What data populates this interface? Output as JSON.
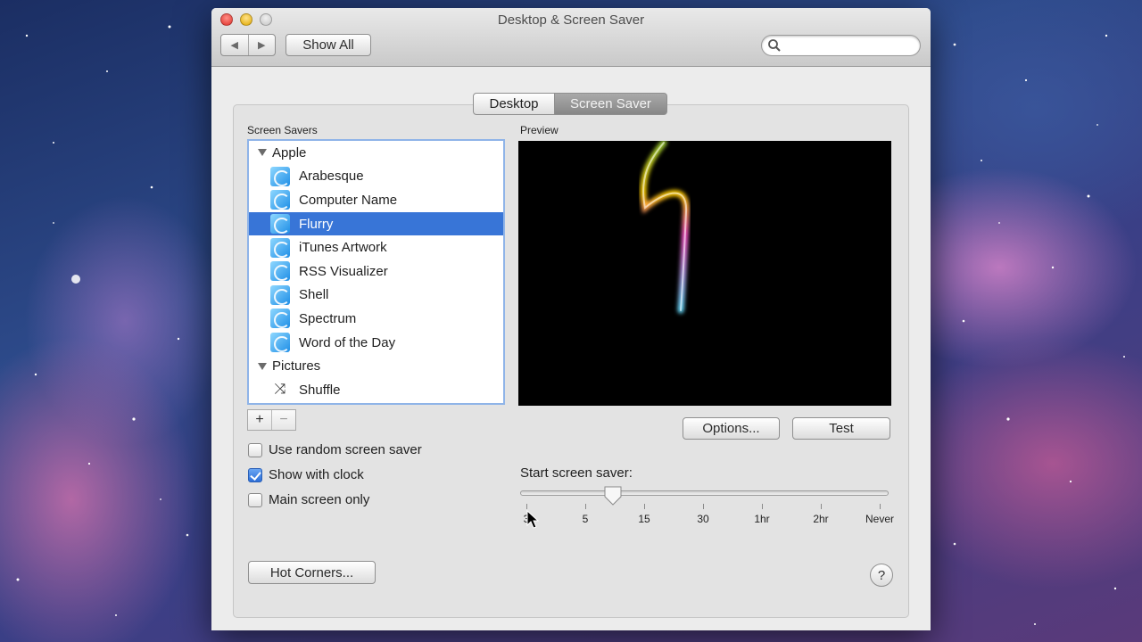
{
  "window": {
    "title": "Desktop & Screen Saver",
    "show_all_label": "Show All",
    "search": {
      "placeholder": "",
      "value": ""
    }
  },
  "tabs": [
    {
      "label": "Desktop",
      "selected": false
    },
    {
      "label": "Screen Saver",
      "selected": true
    }
  ],
  "screen_savers": {
    "header": "Screen Savers",
    "groups": [
      {
        "name": "Apple",
        "items": [
          "Arabesque",
          "Computer Name",
          "Flurry",
          "iTunes Artwork",
          "RSS Visualizer",
          "Shell",
          "Spectrum",
          "Word of the Day"
        ]
      },
      {
        "name": "Pictures",
        "items": [
          "Shuffle"
        ]
      }
    ],
    "selected": "Flurry",
    "add_label": "+",
    "remove_label": "−"
  },
  "preview": {
    "label": "Preview",
    "options_label": "Options...",
    "test_label": "Test"
  },
  "options": {
    "random": {
      "label": "Use random screen saver",
      "checked": false
    },
    "clock": {
      "label": "Show with clock",
      "checked": true
    },
    "main_only": {
      "label": "Main screen only",
      "checked": false
    }
  },
  "start_saver": {
    "label": "Start screen saver:",
    "ticks": [
      "3",
      "5",
      "15",
      "30",
      "1hr",
      "2hr",
      "Never"
    ],
    "value_between": [
      "5",
      "15"
    ]
  },
  "hot_corners_label": "Hot Corners...",
  "help_label": "?",
  "colors": {
    "selection": "#3875d7",
    "list_focus": "#8fb4e8"
  }
}
